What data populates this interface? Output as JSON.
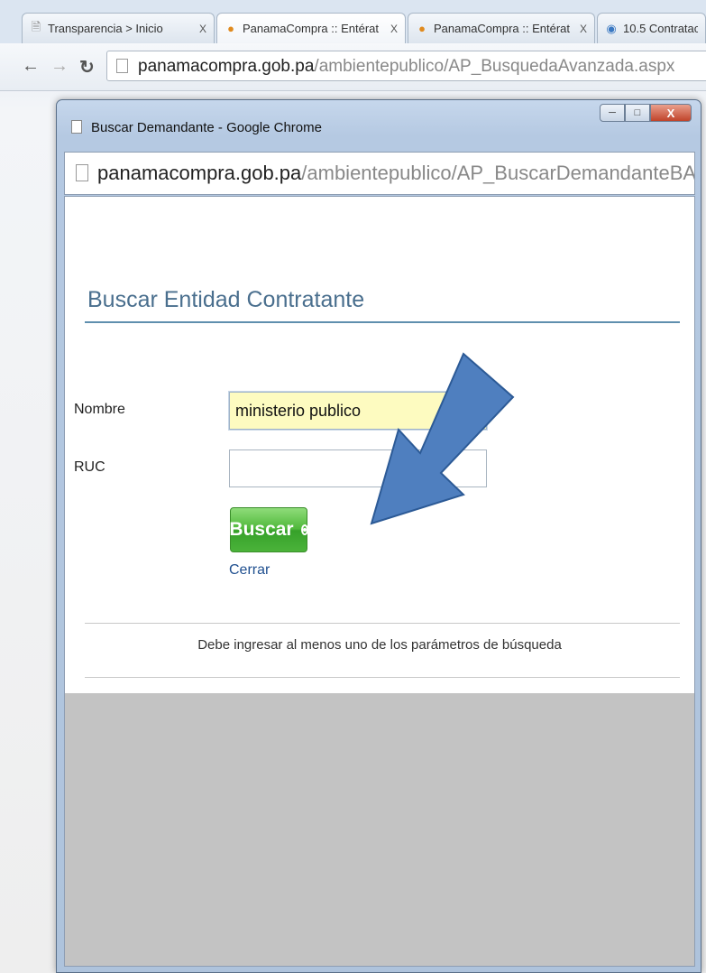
{
  "browser": {
    "tabs": [
      {
        "label": "Transparencia > Inicio",
        "close": "X",
        "active": false
      },
      {
        "label": "PanamaCompra :: Entérat",
        "close": "X",
        "active": true
      },
      {
        "label": "PanamaCompra :: Entérat",
        "close": "X",
        "active": false
      },
      {
        "label": "10.5 Contratac",
        "close": "",
        "active": false
      }
    ],
    "url_host": "panamacompra.gob.pa",
    "url_path": "/ambientepublico/AP_BusquedaAvanzada.aspx"
  },
  "popup": {
    "title": "Buscar Demandante - Google Chrome",
    "close_label": "X",
    "url_host": "panamacompra.gob.pa",
    "url_path": "/ambientepublico/AP_BuscarDemandanteBA.aspx?Popup=True"
  },
  "form": {
    "section_title": "Buscar Entidad Contratante",
    "nombre_label": "Nombre",
    "nombre_value": "ministerio publico",
    "ruc_label": "RUC",
    "ruc_value": "",
    "buscar_label": "Buscar",
    "cerrar_label": "Cerrar",
    "hint": "Debe ingresar al menos uno de los parámetros de búsqueda"
  },
  "colors": {
    "section_title": "#4a6f8e",
    "buscar_button": "#4fb83a",
    "input_highlight": "#fdfbc0",
    "annotation_arrow": "#4f7fbf"
  }
}
